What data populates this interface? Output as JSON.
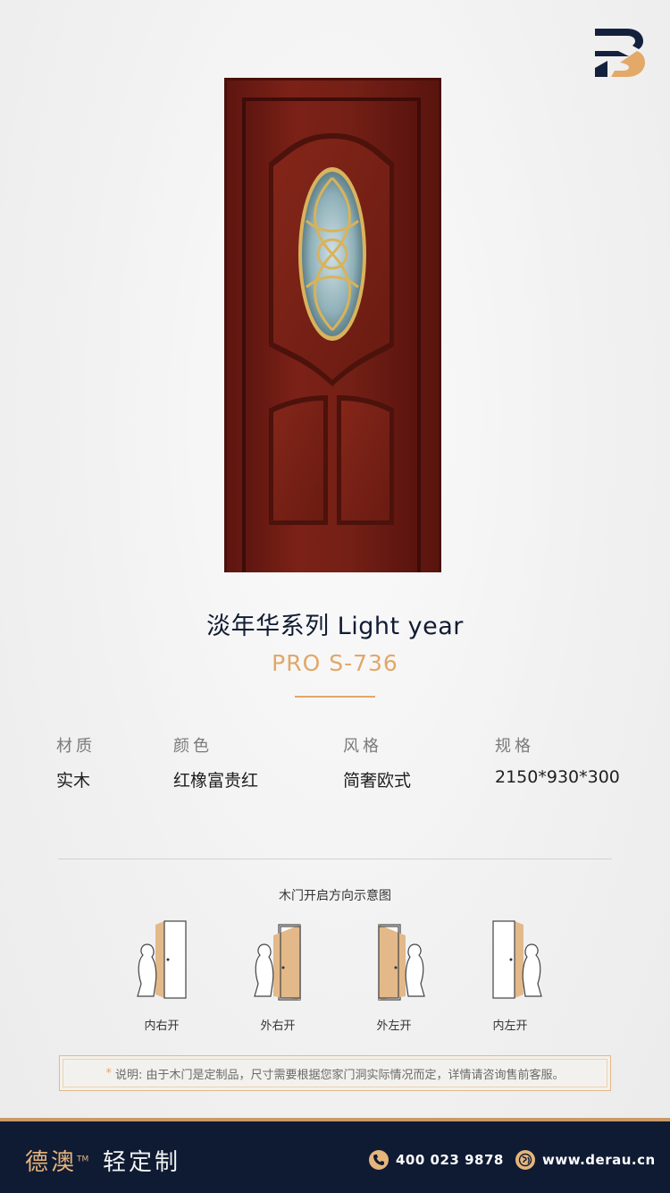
{
  "product": {
    "series_title": "淡年华系列  Light year",
    "model": "PRO S-736"
  },
  "specs": [
    {
      "label": "材质",
      "value": "实木"
    },
    {
      "label": "颜色",
      "value": "红橡富贵红"
    },
    {
      "label": "风格",
      "value": "简奢欧式"
    },
    {
      "label": "规格",
      "value": "2150*930*300"
    }
  ],
  "diagram": {
    "title": "木门开启方向示意图",
    "items": [
      {
        "label": "内右开"
      },
      {
        "label": "外右开"
      },
      {
        "label": "外左开"
      },
      {
        "label": "内左开"
      }
    ]
  },
  "note": {
    "marker": "*",
    "text": "说明: 由于木门是定制品，尺寸需要根据您家门洞实际情况而定，详情请咨询售前客服。"
  },
  "footer": {
    "brand": "德澳",
    "trademark": "TM",
    "slogan": "轻定制",
    "phone": "400 023 9878",
    "website": "www.derau.cn",
    "phone_icon": "phone-icon",
    "globe_icon": "globe-icon"
  },
  "colors": {
    "accent_gold": "#e0a868",
    "navy": "#0f1b33",
    "door_red": "#7a1d14"
  }
}
